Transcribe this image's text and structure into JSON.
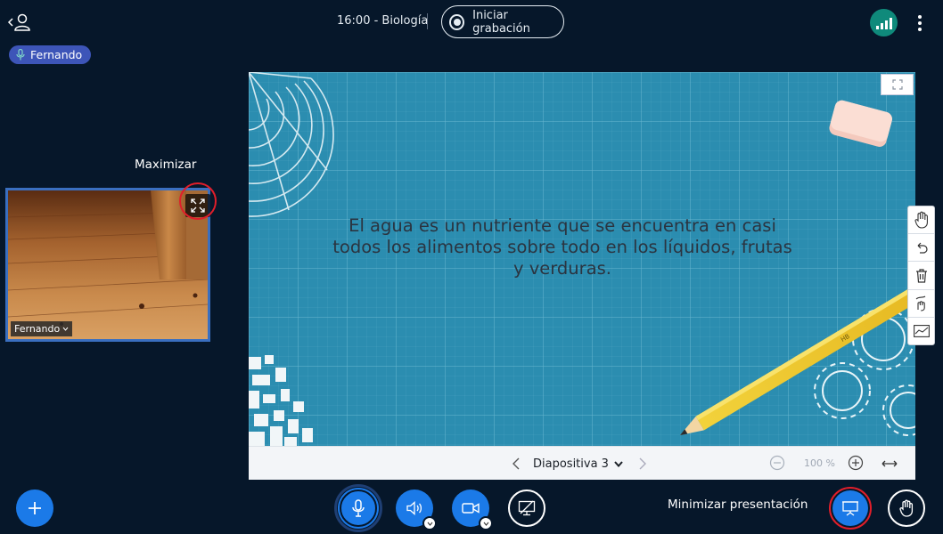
{
  "header": {
    "meeting_title": "16:00 - Biología",
    "record_label": "Iniciar grabación"
  },
  "talking_indicator": {
    "name": "Fernando"
  },
  "webcam": {
    "tooltip": "Maximizar",
    "user_name": "Fernando"
  },
  "presentation": {
    "slide_text": "El agua es un nutriente que se encuentra en casi todos los alimentos sobre todo en los líquidos, frutas y verduras.",
    "current_slide_label": "Diapositiva 3",
    "zoom_value": "100 %"
  },
  "footer": {
    "minimize_label": "Minimizar presentación"
  },
  "colors": {
    "background": "#06172a",
    "accent_blue": "#1b7ae8",
    "connection_green": "#0f8a7b",
    "highlight_red": "#e01e2a",
    "talking_badge": "#3d55b8",
    "slide_background": "#2b8db0"
  }
}
